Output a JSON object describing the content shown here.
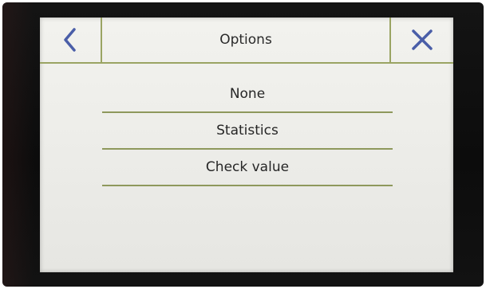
{
  "header": {
    "title": "Options",
    "back_icon": "chevron-left-icon",
    "close_icon": "close-icon"
  },
  "menu": {
    "items": [
      {
        "label": "None"
      },
      {
        "label": "Statistics"
      },
      {
        "label": "Check value"
      }
    ]
  },
  "colors": {
    "divider": "#9aa463",
    "icon_blue": "#4a5ea8",
    "bezel": "#111111",
    "screen": "#eeeeea"
  }
}
